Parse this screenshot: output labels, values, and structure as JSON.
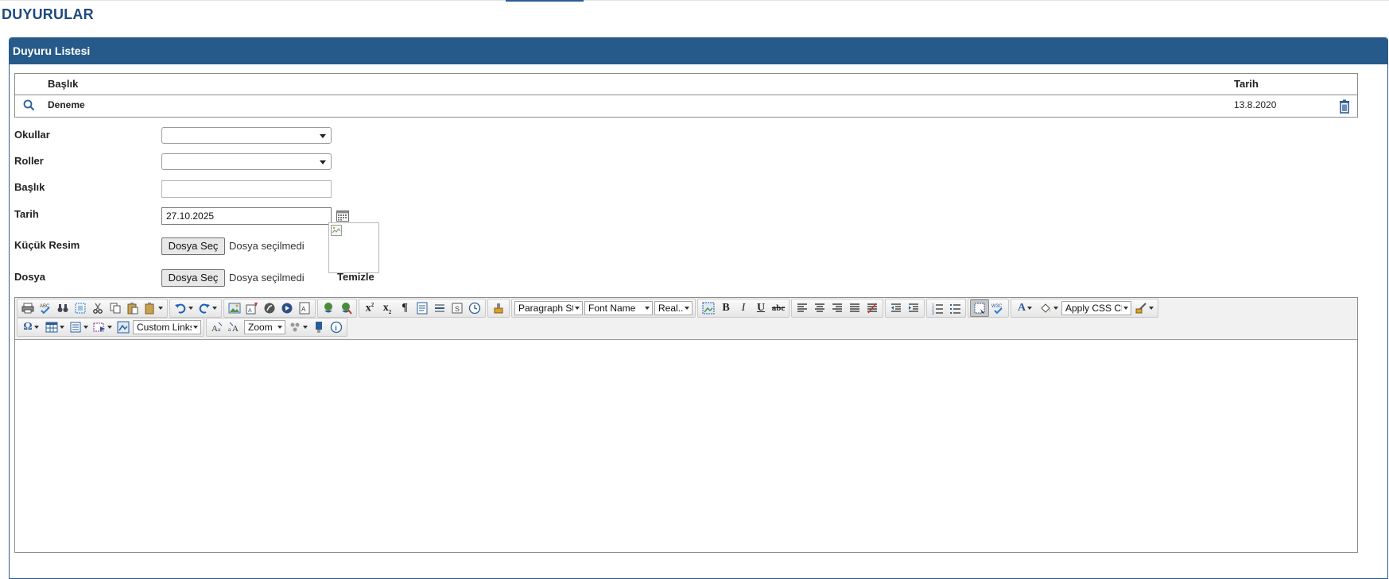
{
  "page": {
    "title": "DUYURULAR"
  },
  "panel": {
    "header": "Duyuru Listesi"
  },
  "list": {
    "columns": {
      "title": "Başlık",
      "date": "Tarih"
    },
    "rows": [
      {
        "title": "Deneme",
        "date": "13.8.2020"
      }
    ]
  },
  "form": {
    "schools": {
      "label": "Okullar",
      "value": ""
    },
    "roles": {
      "label": "Roller",
      "value": ""
    },
    "title": {
      "label": "Başlık",
      "value": ""
    },
    "date": {
      "label": "Tarih",
      "value": "27.10.2025"
    },
    "thumbnail": {
      "label": "Küçük Resim",
      "button": "Dosya Seç",
      "status": "Dosya seçilmedi"
    },
    "file": {
      "label": "Dosya",
      "button": "Dosya Seç",
      "status": "Dosya seçilmedi"
    },
    "clear_label": "Temizle"
  },
  "editor": {
    "dropdowns": {
      "paragraph_style": "Paragraph St...",
      "font_name": "Font Name",
      "font_size": "Real...",
      "css_class": "Apply CSS Cl...",
      "custom_links": "Custom Links",
      "zoom": "Zoom"
    },
    "colors": {
      "accent": "#265a8a",
      "title": "#1e4a7c"
    }
  }
}
